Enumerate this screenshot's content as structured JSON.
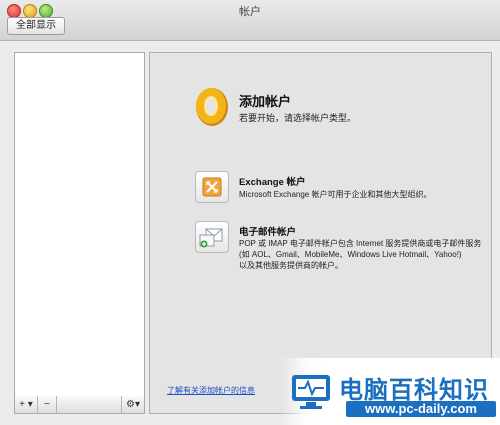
{
  "window": {
    "title": "帐户"
  },
  "toolbar": {
    "show_all_label": "全部显示"
  },
  "sidebar": {
    "add_label": "+ ▾",
    "remove_label": "−",
    "gear_label": "⚙▾"
  },
  "welcome": {
    "title": "添加帐户",
    "subtitle": "若要开始，请选择帐户类型。"
  },
  "exchange": {
    "title": "Exchange 帐户",
    "description": "Microsoft Exchange 帐户可用于企业和其他大型组织。"
  },
  "email": {
    "title": "电子邮件帐户",
    "description_line1": "POP 或 IMAP 电子邮件帐户包含 Internet 服务提供商或电子邮件服务",
    "description_line2": "(如 AOL、Gmail、MobileMe、Windows Live Hotmail、Yahoo!)",
    "description_line3": "以及其他服务提供商的帐户。"
  },
  "footer": {
    "learn_more_link": "了解有关添加帐户的信息"
  },
  "watermark": {
    "brand": "电脑百科知识",
    "url": "www.pc-daily.com"
  },
  "colors": {
    "link": "#1b4fc4",
    "watermark_blue": "#1a6fc0",
    "outlook_orange": "#e9a20f"
  }
}
